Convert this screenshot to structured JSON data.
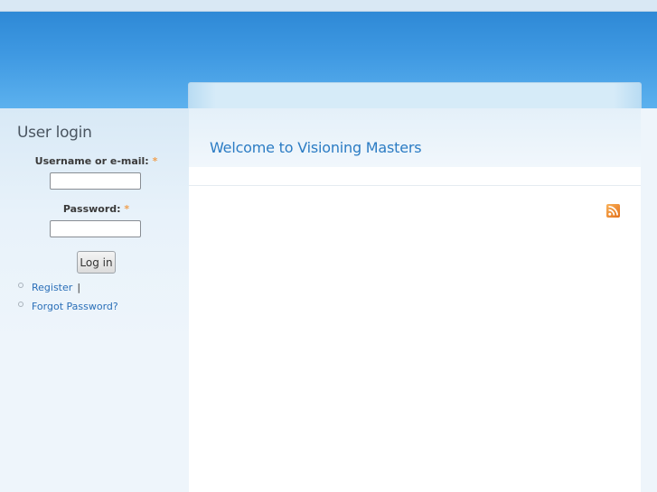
{
  "user_login": {
    "title": "User login",
    "username_label": "Username or e-mail:",
    "password_label": "Password:",
    "required_marker": "*",
    "username_value": "",
    "password_value": "",
    "login_button_label": "Log in",
    "links": [
      {
        "label": "Register",
        "separator": "|"
      },
      {
        "label": "Forgot Password?"
      }
    ]
  },
  "main": {
    "page_title": "Welcome to Visioning Masters",
    "feed_icon": "rss-feed-icon"
  },
  "colors": {
    "header_blue": "#3f99e2",
    "link_blue": "#2a6fb8",
    "title_blue": "#2b7cc4",
    "required_orange": "#f0a050",
    "rss_orange": "#f08a24"
  }
}
